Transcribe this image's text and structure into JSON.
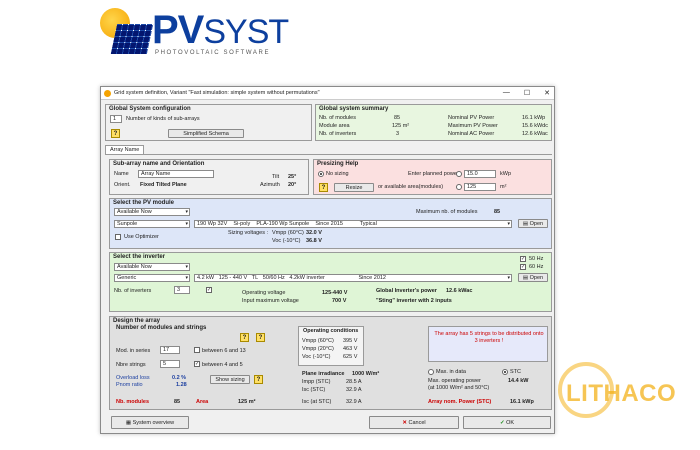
{
  "logo": {
    "brand_pv": "PV",
    "brand_syst": "SYST",
    "tagline": "PHOTOVOLTAIC SOFTWARE"
  },
  "window": {
    "title": "Grid system definition, Variant  \"Fast simulation: simple system without permutations\"",
    "min": "—",
    "max": "☐",
    "close": "✕"
  },
  "global_config": {
    "header": "Global System configuration",
    "kinds_value": "1",
    "kinds_label": "Number of kinds of sub-arrays",
    "simplified_button": "Simplified Schema"
  },
  "global_summary": {
    "header": "Global system summary",
    "rows": [
      {
        "label": "Nb. of modules",
        "value": "85",
        "label2": "Nominal PV Power",
        "value2": "16.1 kWp"
      },
      {
        "label": "Module area",
        "value": "125 m²",
        "label2": "Maximum PV Power",
        "value2": "15.6 kWdc"
      },
      {
        "label": "Nb. of inverters",
        "value": "3",
        "label2": "Nominal AC Power",
        "value2": "12.6 kWac"
      }
    ]
  },
  "tabs": [
    "Array Name"
  ],
  "subarray": {
    "header": "Sub-array name and Orientation",
    "name_label": "Name",
    "name_value": "Array Name",
    "orient_label": "Orient.",
    "orient_value": "Fixed Tilted Plane",
    "tilt_label": "Tilt",
    "tilt_value": "25°",
    "azimuth_label": "Azimuth",
    "azimuth_value": "20°"
  },
  "presizing": {
    "header": "Presizing Help",
    "no_sizing": "No sizing",
    "enter_power": "Enter planned power",
    "power_value": "15.0",
    "power_unit": "kWp",
    "or_area": "or available area(modules)",
    "area_value": "125",
    "area_unit": "m²",
    "resize_button": "Resize"
  },
  "pv_module": {
    "header": "Select the PV module",
    "filter": "Available Now",
    "max_label": "Maximum nb. of modules",
    "max_value": "85",
    "manufacturer": "Sunpole",
    "power": "190 Wp 32V",
    "tech": "Si-poly",
    "model": "PLA-190 Wp Sunpole",
    "since": "Since 2015",
    "type": "Typical",
    "open_button": "Open",
    "use_optimizer": "Use Optimizer",
    "sizing_label": "Sizing voltages :",
    "vmpp_label": "Vmpp (60°C)",
    "vmpp_value": "32.0 V",
    "voc_label": "Voc (-10°C)",
    "voc_value": "36.8 V"
  },
  "inverter": {
    "header": "Select the inverter",
    "filter": "Available Now",
    "hz50": "50 Hz",
    "hz60": "60 Hz",
    "manufacturer": "Generic",
    "power": "4.2 kW",
    "voltage": "125 - 440 V",
    "tl": "TL",
    "hz": "50/60 Hz",
    "model": "4.2kW inverter",
    "since": "Since 2012",
    "open_button": "Open",
    "nb_label": "Nb. of inverters",
    "nb_value": "3",
    "operating_label": "Operating voltage",
    "operating_value": "125-440 V",
    "max_input_label": "Input maximum voltage",
    "max_input_value": "700 V",
    "global_power_label": "Global Inverter's power",
    "global_power_value": "12.6 kWac",
    "sting_note": "\"Sting\" inverter with 2 inputs"
  },
  "design": {
    "header": "Design the array",
    "sub_header": "Number of modules and strings",
    "mod_series_label": "Mod. in series",
    "mod_series_value": "17",
    "between_series": "between 6 and 13",
    "nb_strings_label": "Nbre strings",
    "nb_strings_value": "5",
    "between_strings": "between 4 and 5",
    "overload_label": "Overload loss",
    "overload_value": "0.2 %",
    "pnom_label": "Pnom ratio",
    "pnom_value": "1.28",
    "show_sizing_button": "Show sizing",
    "nb_modules_label": "Nb. modules",
    "nb_modules_value": "85",
    "area_label": "Area",
    "area_value": "125 m²",
    "op_cond_header": "Operating conditions",
    "vmpp60_label": "Vmpp (60°C)",
    "vmpp60_value": "395 V",
    "vmpp20_label": "Vmpp (20°C)",
    "vmpp20_value": "463 V",
    "voc10_label": "Voc (-10°C)",
    "voc10_value": "625 V",
    "irr_label": "Plane irradiance",
    "irr_value": "1000 W/m²",
    "impp_label": "Impp (STC)",
    "impp_value": "28.5 A",
    "isc_label": "Isc (STC)",
    "isc_value": "32.9 A",
    "isc_at_label": "Isc (at STC)",
    "isc_at_value": "32.9 A",
    "max_in_data": "Max. in data",
    "stc": "STC",
    "max_op_power_label": "Max. operating power",
    "max_op_power_sub": "(at 1000 W/m² and 50°C)",
    "max_op_power_value": "14.4 kW",
    "array_nom_label": "Array nom. Power (STC)",
    "array_nom_value": "16.1 kWp",
    "warning": "The array has 5 strings to be distributed onto 3 inverters !"
  },
  "footer": {
    "overview_button": "System overview",
    "cancel_button": "Cancel",
    "ok_button": "OK"
  },
  "watermark": {
    "text": "LITHACO"
  },
  "colors": {
    "summary_bg": "#e8f6e0",
    "presizing_bg": "#fbe0e0",
    "module_bg": "#dde6f8",
    "inverter_bg": "#dff5d6",
    "design_bg": "#e0e0e0",
    "warning_bg": "#e6e9fa"
  }
}
